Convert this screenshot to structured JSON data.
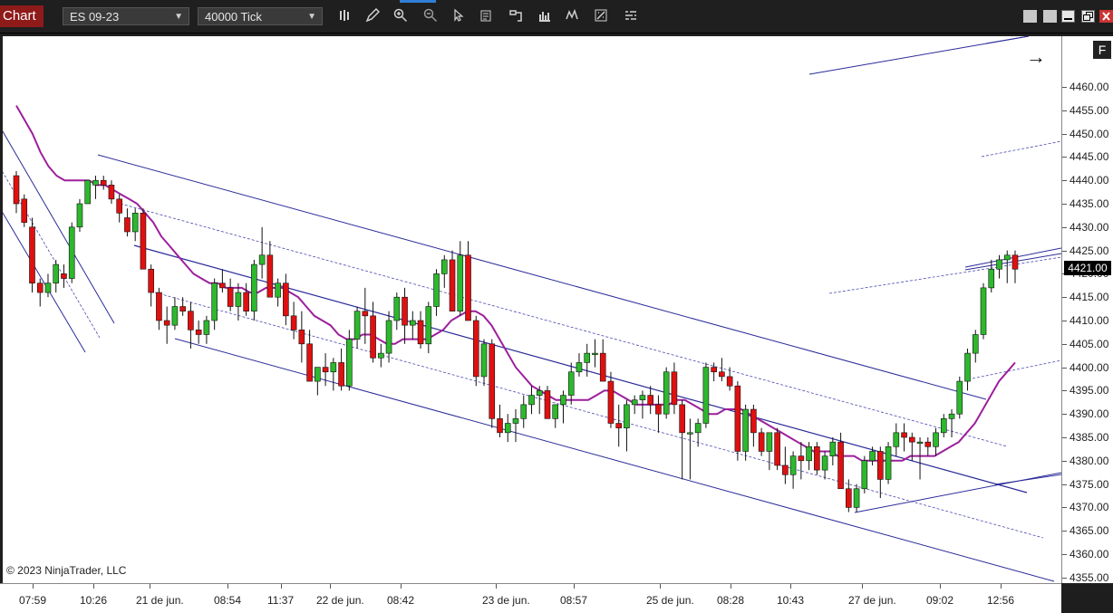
{
  "toolbar": {
    "chart_tab": "Chart",
    "instrument": "ES 09-23",
    "period": "40000 Tick",
    "tools": [
      "bar-chart-icon",
      "pencil-icon",
      "zoom-in-icon",
      "zoom-out-icon",
      "pointer-icon",
      "data-box-icon",
      "properties-icon",
      "indicators-icon",
      "strategies-icon",
      "templates-icon",
      "chart-trader-icon"
    ]
  },
  "colors": {
    "up": "#2db82d",
    "down": "#e01010",
    "channel": "#2b2b9a",
    "ma": "#9c1f9c"
  },
  "y_axis": {
    "labels": [
      "4460.00",
      "4455.00",
      "4450.00",
      "4445.00",
      "4440.00",
      "4435.00",
      "4430.00",
      "4425.00",
      "4420.00",
      "4415.00",
      "4410.00",
      "4405.00",
      "4400.00",
      "4395.00",
      "4390.00",
      "4385.00",
      "4380.00",
      "4375.00",
      "4370.00",
      "4365.00",
      "4360.00",
      "4355.00"
    ],
    "current_price": "4421.00"
  },
  "x_axis": {
    "labels": [
      "07:59",
      "10:26",
      "21 de jun.",
      "08:54",
      "11:37",
      "22 de jun.",
      "08:42",
      "23 de jun.",
      "08:57",
      "25 de jun.",
      "08:28",
      "10:43",
      "27 de jun.",
      "09:02",
      "12:56"
    ]
  },
  "copyright": "© 2023 NinjaTrader, LLC",
  "f_button": "F",
  "chart_data": {
    "type": "candlestick",
    "ylim": [
      4353,
      4466
    ],
    "candles": [
      [
        4441,
        4442,
        4433,
        4435
      ],
      [
        4436,
        4437,
        4430,
        4431
      ],
      [
        4430,
        4432,
        4416,
        4418
      ],
      [
        4418,
        4419,
        4413,
        4416
      ],
      [
        4416,
        4420,
        4415,
        4418
      ],
      [
        4418,
        4423,
        4416,
        4422
      ],
      [
        4420,
        4422,
        4417,
        4419
      ],
      [
        4419,
        4431,
        4418,
        4430
      ],
      [
        4430,
        4436,
        4429,
        4435
      ],
      [
        4435,
        4439,
        4435,
        4440
      ],
      [
        4439,
        4441,
        4436,
        4440
      ],
      [
        4440,
        4441,
        4438,
        4439
      ],
      [
        4439,
        4440,
        4435,
        4436
      ],
      [
        4436,
        4437,
        4431,
        4433
      ],
      [
        4432,
        4434,
        4428,
        4429
      ],
      [
        4429,
        4434,
        4427,
        4433
      ],
      [
        4433,
        4434,
        4421,
        4421
      ],
      [
        4421,
        4422,
        4413,
        4416
      ],
      [
        4416,
        4417,
        4408,
        4410
      ],
      [
        4410,
        4413,
        4405,
        4409
      ],
      [
        4409,
        4415,
        4408,
        4413
      ],
      [
        4413,
        4415,
        4411,
        4412
      ],
      [
        4412,
        4414,
        4404,
        4408
      ],
      [
        4408,
        4410,
        4405,
        4407
      ],
      [
        4407,
        4411,
        4405,
        4410
      ],
      [
        4410,
        4419,
        4408,
        4418
      ],
      [
        4418,
        4421,
        4416,
        4417
      ],
      [
        4417,
        4419,
        4412,
        4413
      ],
      [
        4413,
        4418,
        4410,
        4416
      ],
      [
        4416,
        4418,
        4411,
        4412
      ],
      [
        4412,
        4423,
        4410,
        4422
      ],
      [
        4422,
        4430,
        4419,
        4424
      ],
      [
        4424,
        4427,
        4415,
        4415
      ],
      [
        4415,
        4419,
        4413,
        4418
      ],
      [
        4418,
        4420,
        4409,
        4411
      ],
      [
        4411,
        4414,
        4406,
        4408
      ],
      [
        4408,
        4412,
        4401,
        4405
      ],
      [
        4405,
        4408,
        4397,
        4397
      ],
      [
        4397,
        4400,
        4394,
        4400
      ],
      [
        4400,
        4403,
        4396,
        4399
      ],
      [
        4399,
        4402,
        4395,
        4401
      ],
      [
        4401,
        4404,
        4395,
        4396
      ],
      [
        4396,
        4408,
        4395,
        4406
      ],
      [
        4406,
        4413,
        4404,
        4412
      ],
      [
        4412,
        4417,
        4405,
        4411
      ],
      [
        4411,
        4414,
        4401,
        4402
      ],
      [
        4402,
        4405,
        4400,
        4403
      ],
      [
        4403,
        4412,
        4401,
        4410
      ],
      [
        4410,
        4416,
        4408,
        4415
      ],
      [
        4415,
        4417,
        4405,
        4409
      ],
      [
        4409,
        4412,
        4406,
        4410
      ],
      [
        4410,
        4412,
        4404,
        4405
      ],
      [
        4405,
        4414,
        4403,
        4413
      ],
      [
        4413,
        4421,
        4411,
        4420
      ],
      [
        4420,
        4424,
        4417,
        4423
      ],
      [
        4423,
        4425,
        4412,
        4412
      ],
      [
        4412,
        4427,
        4411,
        4424
      ],
      [
        4424,
        4427,
        4410,
        4410
      ],
      [
        4410,
        4411,
        4396,
        4398
      ],
      [
        4398,
        4406,
        4396,
        4405
      ],
      [
        4405,
        4406,
        4387,
        4389
      ],
      [
        4389,
        4392,
        4385,
        4386
      ],
      [
        4386,
        4390,
        4384,
        4388
      ],
      [
        4388,
        4391,
        4384,
        4389
      ],
      [
        4389,
        4394,
        4387,
        4392
      ],
      [
        4392,
        4396,
        4390,
        4394
      ],
      [
        4394,
        4396,
        4390,
        4395
      ],
      [
        4395,
        4396,
        4389,
        4389
      ],
      [
        4389,
        4392,
        4387,
        4392
      ],
      [
        4392,
        4395,
        4388,
        4394
      ],
      [
        4394,
        4401,
        4392,
        4399
      ],
      [
        4399,
        4403,
        4398,
        4401
      ],
      [
        4401,
        4405,
        4398,
        4403
      ],
      [
        4403,
        4406,
        4400,
        4403
      ],
      [
        4403,
        4406,
        4397,
        4397
      ],
      [
        4397,
        4399,
        4387,
        4388
      ],
      [
        4388,
        4392,
        4383,
        4387
      ],
      [
        4387,
        4393,
        4382,
        4392
      ],
      [
        4392,
        4394,
        4390,
        4393
      ],
      [
        4393,
        4395,
        4389,
        4394
      ],
      [
        4394,
        4396,
        4390,
        4392
      ],
      [
        4392,
        4394,
        4386,
        4390
      ],
      [
        4390,
        4400,
        4389,
        4399
      ],
      [
        4399,
        4401,
        4390,
        4392
      ],
      [
        4392,
        4393,
        4376,
        4386
      ],
      [
        4386,
        4389,
        4376,
        4386
      ],
      [
        4386,
        4389,
        4383,
        4388
      ],
      [
        4388,
        4401,
        4387,
        4400
      ],
      [
        4400,
        4401,
        4397,
        4399
      ],
      [
        4399,
        4402,
        4397,
        4398
      ],
      [
        4398,
        4400,
        4395,
        4396
      ],
      [
        4396,
        4397,
        4380,
        4382
      ],
      [
        4382,
        4392,
        4380,
        4391
      ],
      [
        4391,
        4392,
        4383,
        4386
      ],
      [
        4386,
        4387,
        4381,
        4382
      ],
      [
        4382,
        4386,
        4378,
        4386
      ],
      [
        4386,
        4387,
        4378,
        4379
      ],
      [
        4379,
        4383,
        4375,
        4377
      ],
      [
        4377,
        4382,
        4374,
        4381
      ],
      [
        4381,
        4384,
        4376,
        4380
      ],
      [
        4380,
        4384,
        4378,
        4383
      ],
      [
        4383,
        4384,
        4377,
        4378
      ],
      [
        4378,
        4382,
        4376,
        4381
      ],
      [
        4381,
        4385,
        4379,
        4384
      ],
      [
        4384,
        4386,
        4374,
        4374
      ],
      [
        4374,
        4376,
        4369,
        4370
      ],
      [
        4370,
        4375,
        4369,
        4374
      ],
      [
        4374,
        4381,
        4373,
        4380
      ],
      [
        4380,
        4383,
        4379,
        4382
      ],
      [
        4382,
        4383,
        4372,
        4376
      ],
      [
        4376,
        4384,
        4375,
        4383
      ],
      [
        4383,
        4388,
        4381,
        4386
      ],
      [
        4386,
        4388,
        4382,
        4385
      ],
      [
        4385,
        4386,
        4380,
        4384
      ],
      [
        4384,
        4385,
        4376,
        4384
      ],
      [
        4384,
        4385,
        4381,
        4383
      ],
      [
        4383,
        4387,
        4381,
        4386
      ],
      [
        4386,
        4390,
        4385,
        4389
      ],
      [
        4389,
        4391,
        4385,
        4390
      ],
      [
        4390,
        4398,
        4389,
        4397
      ],
      [
        4397,
        4404,
        4395,
        4403
      ],
      [
        4403,
        4408,
        4401,
        4407
      ],
      [
        4407,
        4418,
        4406,
        4417
      ],
      [
        4417,
        4423,
        4416,
        4421
      ],
      [
        4421,
        4424,
        4419,
        4423
      ],
      [
        4423,
        4425,
        4418,
        4424
      ],
      [
        4424,
        4425,
        4418,
        4421
      ]
    ],
    "ma": [
      4456,
      4453,
      4450,
      4446,
      4443,
      4441,
      4440,
      4440,
      4440,
      4440,
      4439,
      4439,
      4438,
      4437,
      4436,
      4435,
      4433,
      4431,
      4428,
      4426,
      4424,
      4422,
      4420,
      4419,
      4418,
      4418,
      4417,
      4417,
      4417,
      4416,
      4416,
      4417,
      4417,
      4417,
      4416,
      4415,
      4413,
      4411,
      4410,
      4409,
      4407,
      4406,
      4406,
      4407,
      4407,
      4406,
      4405,
      4405,
      4406,
      4406,
      4406,
      4406,
      4407,
      4408,
      4410,
      4411,
      4412,
      4412,
      4411,
      4409,
      4406,
      4403,
      4400,
      4398,
      4396,
      4395,
      4394,
      4393,
      4393,
      4393,
      4393,
      4393,
      4394,
      4395,
      4395,
      4394,
      4393,
      4392,
      4392,
      4392,
      4392,
      4392,
      4393,
      4393,
      4392,
      4391,
      4390,
      4390,
      4391,
      4391,
      4391,
      4390,
      4389,
      4388,
      4387,
      4386,
      4385,
      4384,
      4383,
      4382,
      4382,
      4382,
      4381,
      4381,
      4381,
      4380,
      4380,
      4380,
      4380,
      4380,
      4380,
      4381,
      4381,
      4381,
      4381,
      4382,
      4383,
      4384,
      4386,
      4388,
      4391,
      4394,
      4397,
      4399,
      4401
    ]
  }
}
